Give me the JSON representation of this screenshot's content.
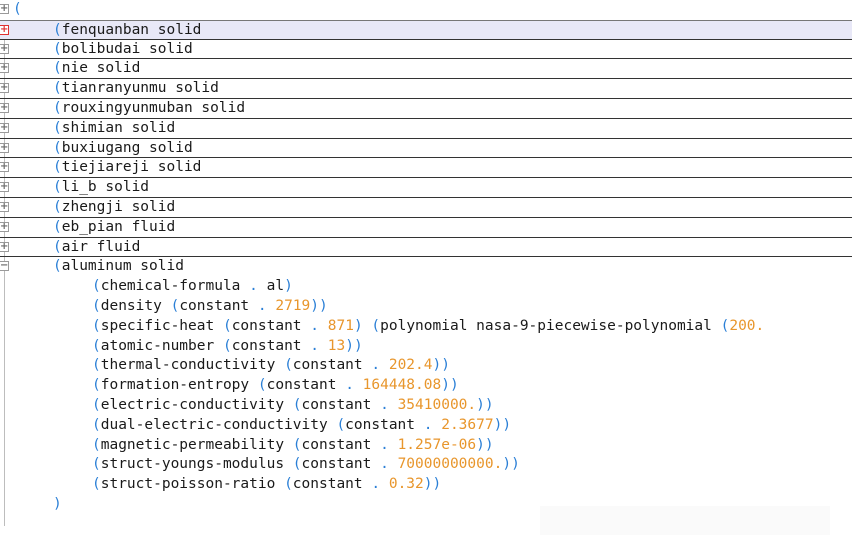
{
  "editor": {
    "root_open_paren": "(",
    "materials_collapsed": [
      {
        "name": "fenquanban solid",
        "highlighted": true
      },
      {
        "name": "bolibudai solid"
      },
      {
        "name": "nie solid"
      },
      {
        "name": "tianranyunmu solid"
      },
      {
        "name": "rouxingyunmuban solid"
      },
      {
        "name": "shimian solid"
      },
      {
        "name": "buxiugang solid"
      },
      {
        "name": "tiejiareji solid"
      },
      {
        "name": "li_b solid"
      },
      {
        "name": "zhengji solid"
      },
      {
        "name": "eb_pian fluid"
      },
      {
        "name": "air fluid"
      }
    ],
    "expanded_material": {
      "name": "aluminum solid",
      "properties": [
        {
          "key": "chemical-formula",
          "dot": ".",
          "value": "al"
        },
        {
          "key": "density",
          "method": "constant",
          "dot": ".",
          "value": "2719"
        },
        {
          "key": "specific-heat",
          "method": "constant",
          "dot": ".",
          "value": "871",
          "extra_method": "polynomial nasa-9-piecewise-polynomial",
          "extra_value": "200."
        },
        {
          "key": "atomic-number",
          "method": "constant",
          "dot": ".",
          "value": "13"
        },
        {
          "key": "thermal-conductivity",
          "method": "constant",
          "dot": ".",
          "value": "202.4"
        },
        {
          "key": "formation-entropy",
          "method": "constant",
          "dot": ".",
          "value": "164448.08"
        },
        {
          "key": "electric-conductivity",
          "method": "constant",
          "dot": ".",
          "value": "35410000."
        },
        {
          "key": "dual-electric-conductivity",
          "method": "constant",
          "dot": ".",
          "value": "2.3677"
        },
        {
          "key": "magnetic-permeability",
          "method": "constant",
          "dot": ".",
          "value": "1.257e-06"
        },
        {
          "key": "struct-youngs-modulus",
          "method": "constant",
          "dot": ".",
          "value": "70000000000."
        },
        {
          "key": "struct-poisson-ratio",
          "method": "constant",
          "dot": ".",
          "value": "0.32"
        }
      ],
      "close_paren": ")"
    }
  },
  "colors": {
    "paren": "#2a7fd6",
    "number": "#e8962c",
    "text": "#1a1a1a",
    "highlight": "#e8e8f7",
    "fold_active": "#e03030"
  },
  "icons": {
    "collapsed": "plus-box-icon",
    "expanded": "minus-box-icon"
  }
}
